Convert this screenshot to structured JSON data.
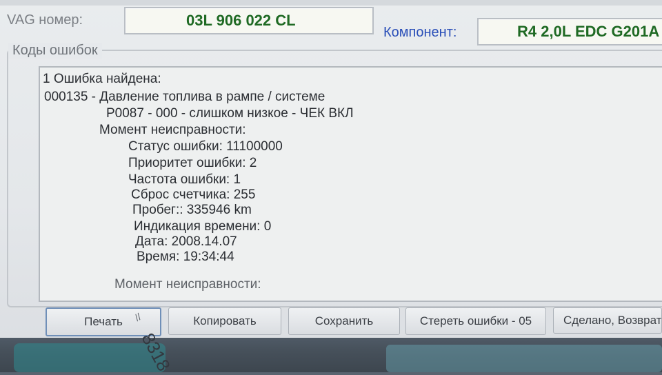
{
  "header": {
    "vag_label": "VAG номер:",
    "vag_value": "03L 906 022 CL",
    "component_label": "Компонент:",
    "component_value": "R4 2,0L EDC G201A"
  },
  "group": {
    "title": "Коды ошибок"
  },
  "fault_report": {
    "lines": [
      "1 Ошибка найдена:",
      "000135 - Давление топлива в рампе / системе",
      "P0087 - 000 - слишком низкое - ЧЕК ВКЛ",
      "Момент неисправности:",
      "Статус ошибки: 11100000",
      "Приоритет ошибки: 2",
      "Частота ошибки: 1",
      "Сброс счетчика: 255",
      "Пробег:: 335946 km",
      "Индикация времени: 0",
      "Дата: 2008.14.07",
      "Время: 19:34:44",
      "Момент неисправности:"
    ]
  },
  "buttons": {
    "print": "Печать",
    "copy": "Копировать",
    "save": "Сохранить",
    "clear": "Стереть ошибки - 05",
    "done": "Сделано, Возврат"
  },
  "marks": {
    "sticker": "8318"
  },
  "colors": {
    "field_text": "#1f6a24",
    "component_label": "#2a4fb8"
  }
}
